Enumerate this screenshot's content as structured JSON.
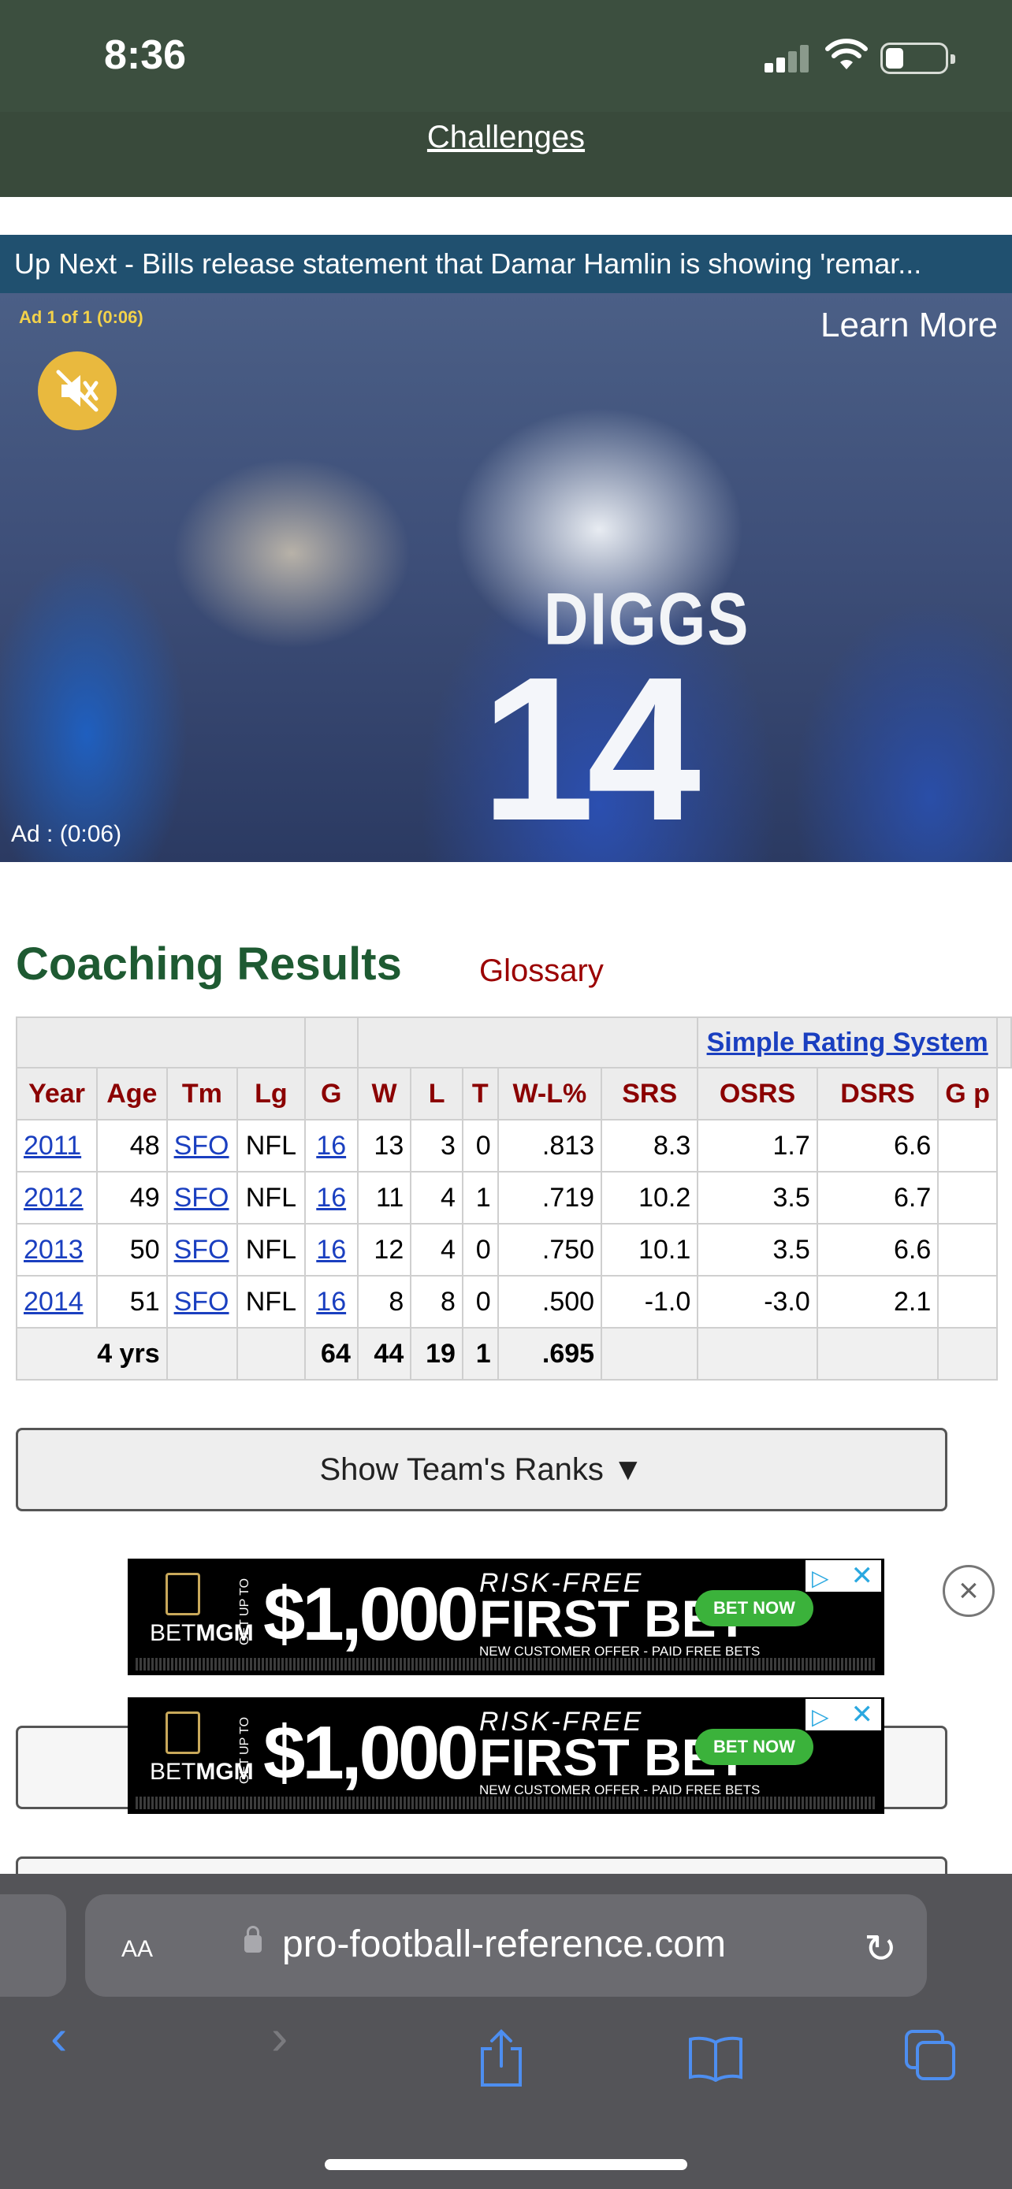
{
  "status": {
    "time": "8:36"
  },
  "header": {
    "challenges": "Challenges"
  },
  "upnext": "Up Next - Bills release statement that Damar Hamlin is showing 'remar...",
  "video": {
    "ad_count": "Ad 1 of 1 (0:06)",
    "learn_more": "Learn More",
    "ad_timer": "Ad : (0:06)",
    "jersey_name": "DIGGS",
    "jersey_number": "14"
  },
  "section": {
    "title": "Coaching Results",
    "glossary": "Glossary"
  },
  "table": {
    "over_header": "Simple Rating System",
    "columns": [
      "Year",
      "Age",
      "Tm",
      "Lg",
      "G",
      "W",
      "L",
      "T",
      "W-L%",
      "SRS",
      "OSRS",
      "DSRS",
      "G p"
    ],
    "rows": [
      [
        "2011",
        "48",
        "SFO",
        "NFL",
        "16",
        "13",
        "3",
        "0",
        ".813",
        "8.3",
        "1.7",
        "6.6"
      ],
      [
        "2012",
        "49",
        "SFO",
        "NFL",
        "16",
        "11",
        "4",
        "1",
        ".719",
        "10.2",
        "3.5",
        "6.7"
      ],
      [
        "2013",
        "50",
        "SFO",
        "NFL",
        "16",
        "12",
        "4",
        "0",
        ".750",
        "10.1",
        "3.5",
        "6.6"
      ],
      [
        "2014",
        "51",
        "SFO",
        "NFL",
        "16",
        "8",
        "8",
        "0",
        ".500",
        "-1.0",
        "-3.0",
        "2.1"
      ]
    ],
    "total": {
      "label": "4 yrs",
      "G": "64",
      "W": "44",
      "L": "19",
      "T": "1",
      "WL": ".695"
    }
  },
  "ranks_button": "Show Team's Ranks ▼",
  "ad_banner": {
    "brand_bet": "BET",
    "brand_mgm": "MGM",
    "get_up_to": "GET UP TO",
    "amount": "$1,000",
    "risk_free": "RISK-FREE",
    "first_bet": "FIRST BET",
    "offer": "NEW CUSTOMER OFFER - PAID FREE BETS",
    "bet_now": "BET NOW"
  },
  "safari": {
    "aa": "AA",
    "url": "pro-football-reference.com"
  },
  "colors": {
    "header_green": "#3c4f3f",
    "title_green": "#1e5a32",
    "table_header_red": "#8b0000",
    "link_blue": "#1a3fc0",
    "upnext_blue": "#20506f",
    "safari_gray": "#545458"
  }
}
